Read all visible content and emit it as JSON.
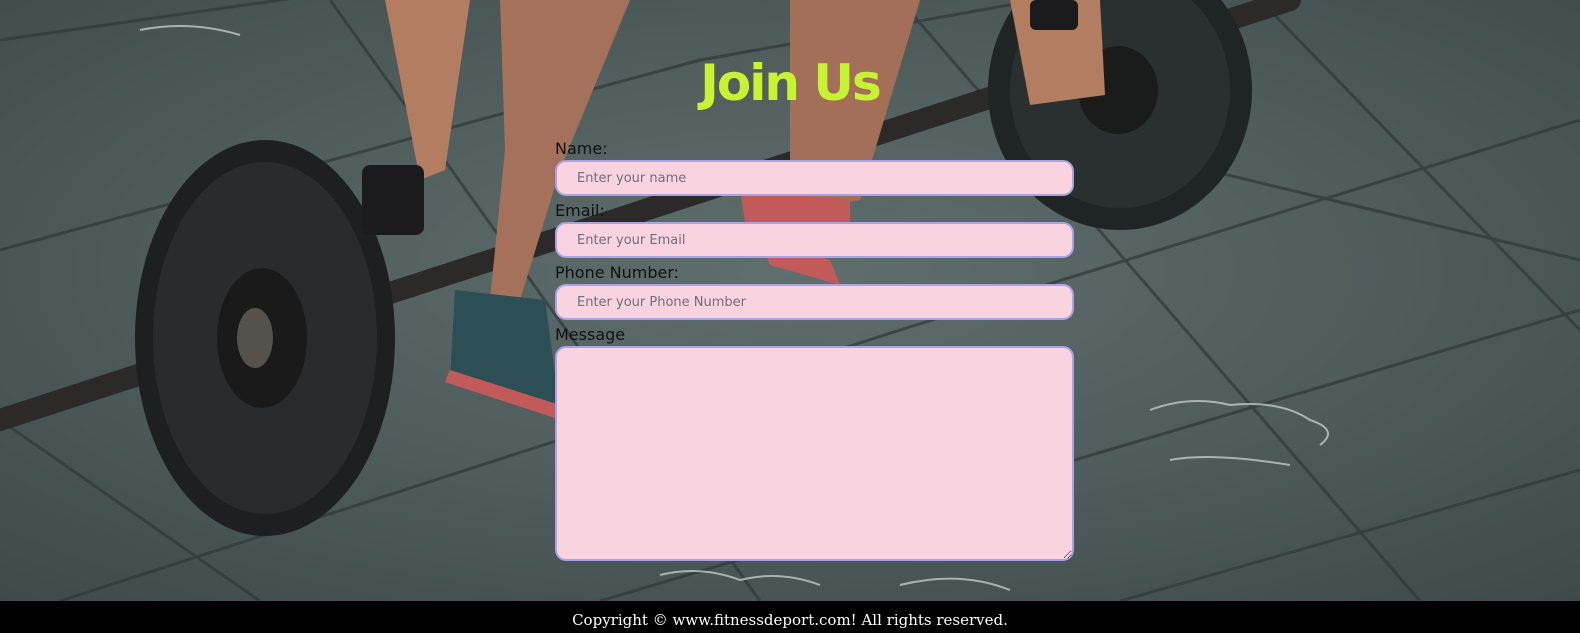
{
  "join": {
    "title": "Join Us"
  },
  "form": {
    "name_label": "Name:",
    "name_placeholder": "Enter your name",
    "email_label": "Email:",
    "email_placeholder": "Enter your Email",
    "phone_label": "Phone Number:",
    "phone_placeholder": "Enter your Phone Number",
    "message_label": "Message"
  },
  "footer": {
    "copyright": "Copyright © www.fitnessdeport.com! All rights reserved."
  },
  "colors": {
    "title": "#c6f432",
    "field_bg": "#f9d3e0",
    "field_border": "#a9a3e6",
    "footer_bg": "#000000"
  }
}
